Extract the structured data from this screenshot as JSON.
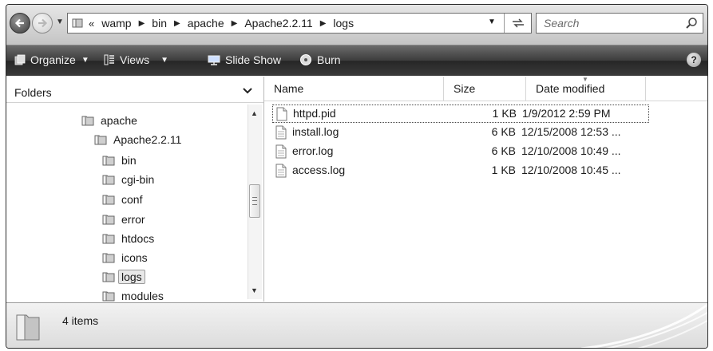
{
  "address_bar": {
    "overflow_chevron": "«",
    "breadcrumbs": [
      "wamp",
      "bin",
      "apache",
      "Apache2.2.11",
      "logs"
    ],
    "search_placeholder": "Search"
  },
  "toolbar": {
    "organize": "Organize",
    "views": "Views",
    "slideshow": "Slide Show",
    "burn": "Burn",
    "help": "?"
  },
  "folders": {
    "title": "Folders",
    "items": [
      {
        "label": "apache"
      },
      {
        "label": "Apache2.2.11"
      },
      {
        "label": "bin"
      },
      {
        "label": "cgi-bin"
      },
      {
        "label": "conf"
      },
      {
        "label": "error"
      },
      {
        "label": "htdocs"
      },
      {
        "label": "icons"
      },
      {
        "label": "logs",
        "selected": true
      },
      {
        "label": "modules"
      }
    ]
  },
  "file_list": {
    "columns": [
      "Name",
      "Size",
      "Date modified"
    ],
    "rows": [
      {
        "name": "httpd.pid",
        "size": "1 KB",
        "date": "1/9/2012 2:59 PM"
      },
      {
        "name": "install.log",
        "size": "6 KB",
        "date": "12/15/2008 12:53 ..."
      },
      {
        "name": "error.log",
        "size": "6 KB",
        "date": "12/10/2008 10:49 ..."
      },
      {
        "name": "access.log",
        "size": "1 KB",
        "date": "12/10/2008 10:45 ..."
      }
    ]
  },
  "status": {
    "item_count": "4 items"
  },
  "icons": {
    "back": "back-arrow-icon",
    "forward": "forward-arrow-icon",
    "folder": "folder-icon",
    "file": "document-icon",
    "search": "search-icon",
    "refresh": "refresh-icon",
    "organize": "organize-icon",
    "views": "views-icon",
    "slideshow": "slideshow-icon",
    "burn": "burn-disc-icon",
    "help": "help-icon"
  }
}
